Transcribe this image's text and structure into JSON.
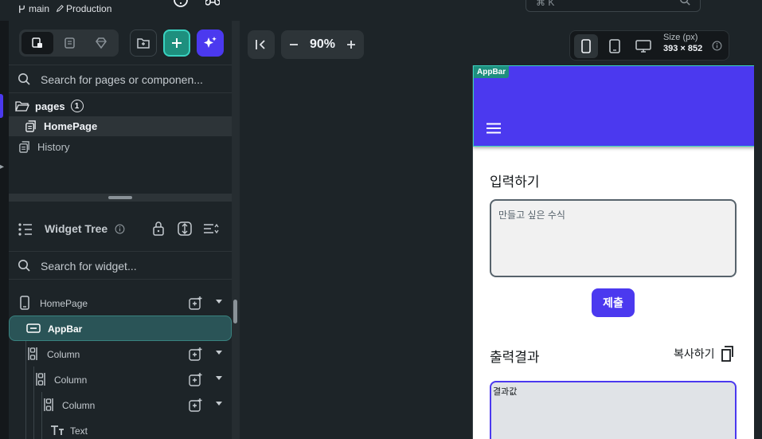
{
  "topbar": {
    "branch": "main",
    "environment": "Production",
    "search_shortcut": "⌘ K"
  },
  "left_panel": {
    "search_placeholder": "Search for pages or componen...",
    "folder": {
      "name": "pages",
      "count": "1"
    },
    "pages": [
      {
        "label": "HomePage",
        "selected": true
      },
      {
        "label": "History",
        "selected": false
      }
    ],
    "widget_tree": {
      "title": "Widget Tree",
      "search_placeholder": "Search for widget...",
      "items": [
        {
          "label": "HomePage",
          "icon": "phone-icon",
          "depth": 0
        },
        {
          "label": "AppBar",
          "icon": "appbar-icon",
          "depth": 1,
          "selected": true
        },
        {
          "label": "Column",
          "icon": "column-icon",
          "depth": 1
        },
        {
          "label": "Column",
          "icon": "column-icon",
          "depth": 2
        },
        {
          "label": "Column",
          "icon": "column-icon",
          "depth": 3
        },
        {
          "label": "Text",
          "icon": "text-icon",
          "depth": 4
        }
      ]
    }
  },
  "canvas": {
    "zoom": "90%",
    "size_label": "Size (px)",
    "size_value": "393 × 852"
  },
  "phone": {
    "appbar_tag": "AppBar",
    "input_heading": "입력하기",
    "input_placeholder": "만들고 싶은 수식",
    "submit_label": "제출",
    "output_heading": "출력결과",
    "copy_label": "복사하기",
    "output_placeholder": "결과값"
  },
  "colors": {
    "primary": "#4b39ef",
    "accent_teal": "#39d2c0",
    "panel_bg": "#1d2428",
    "app_bg": "#14181b"
  }
}
